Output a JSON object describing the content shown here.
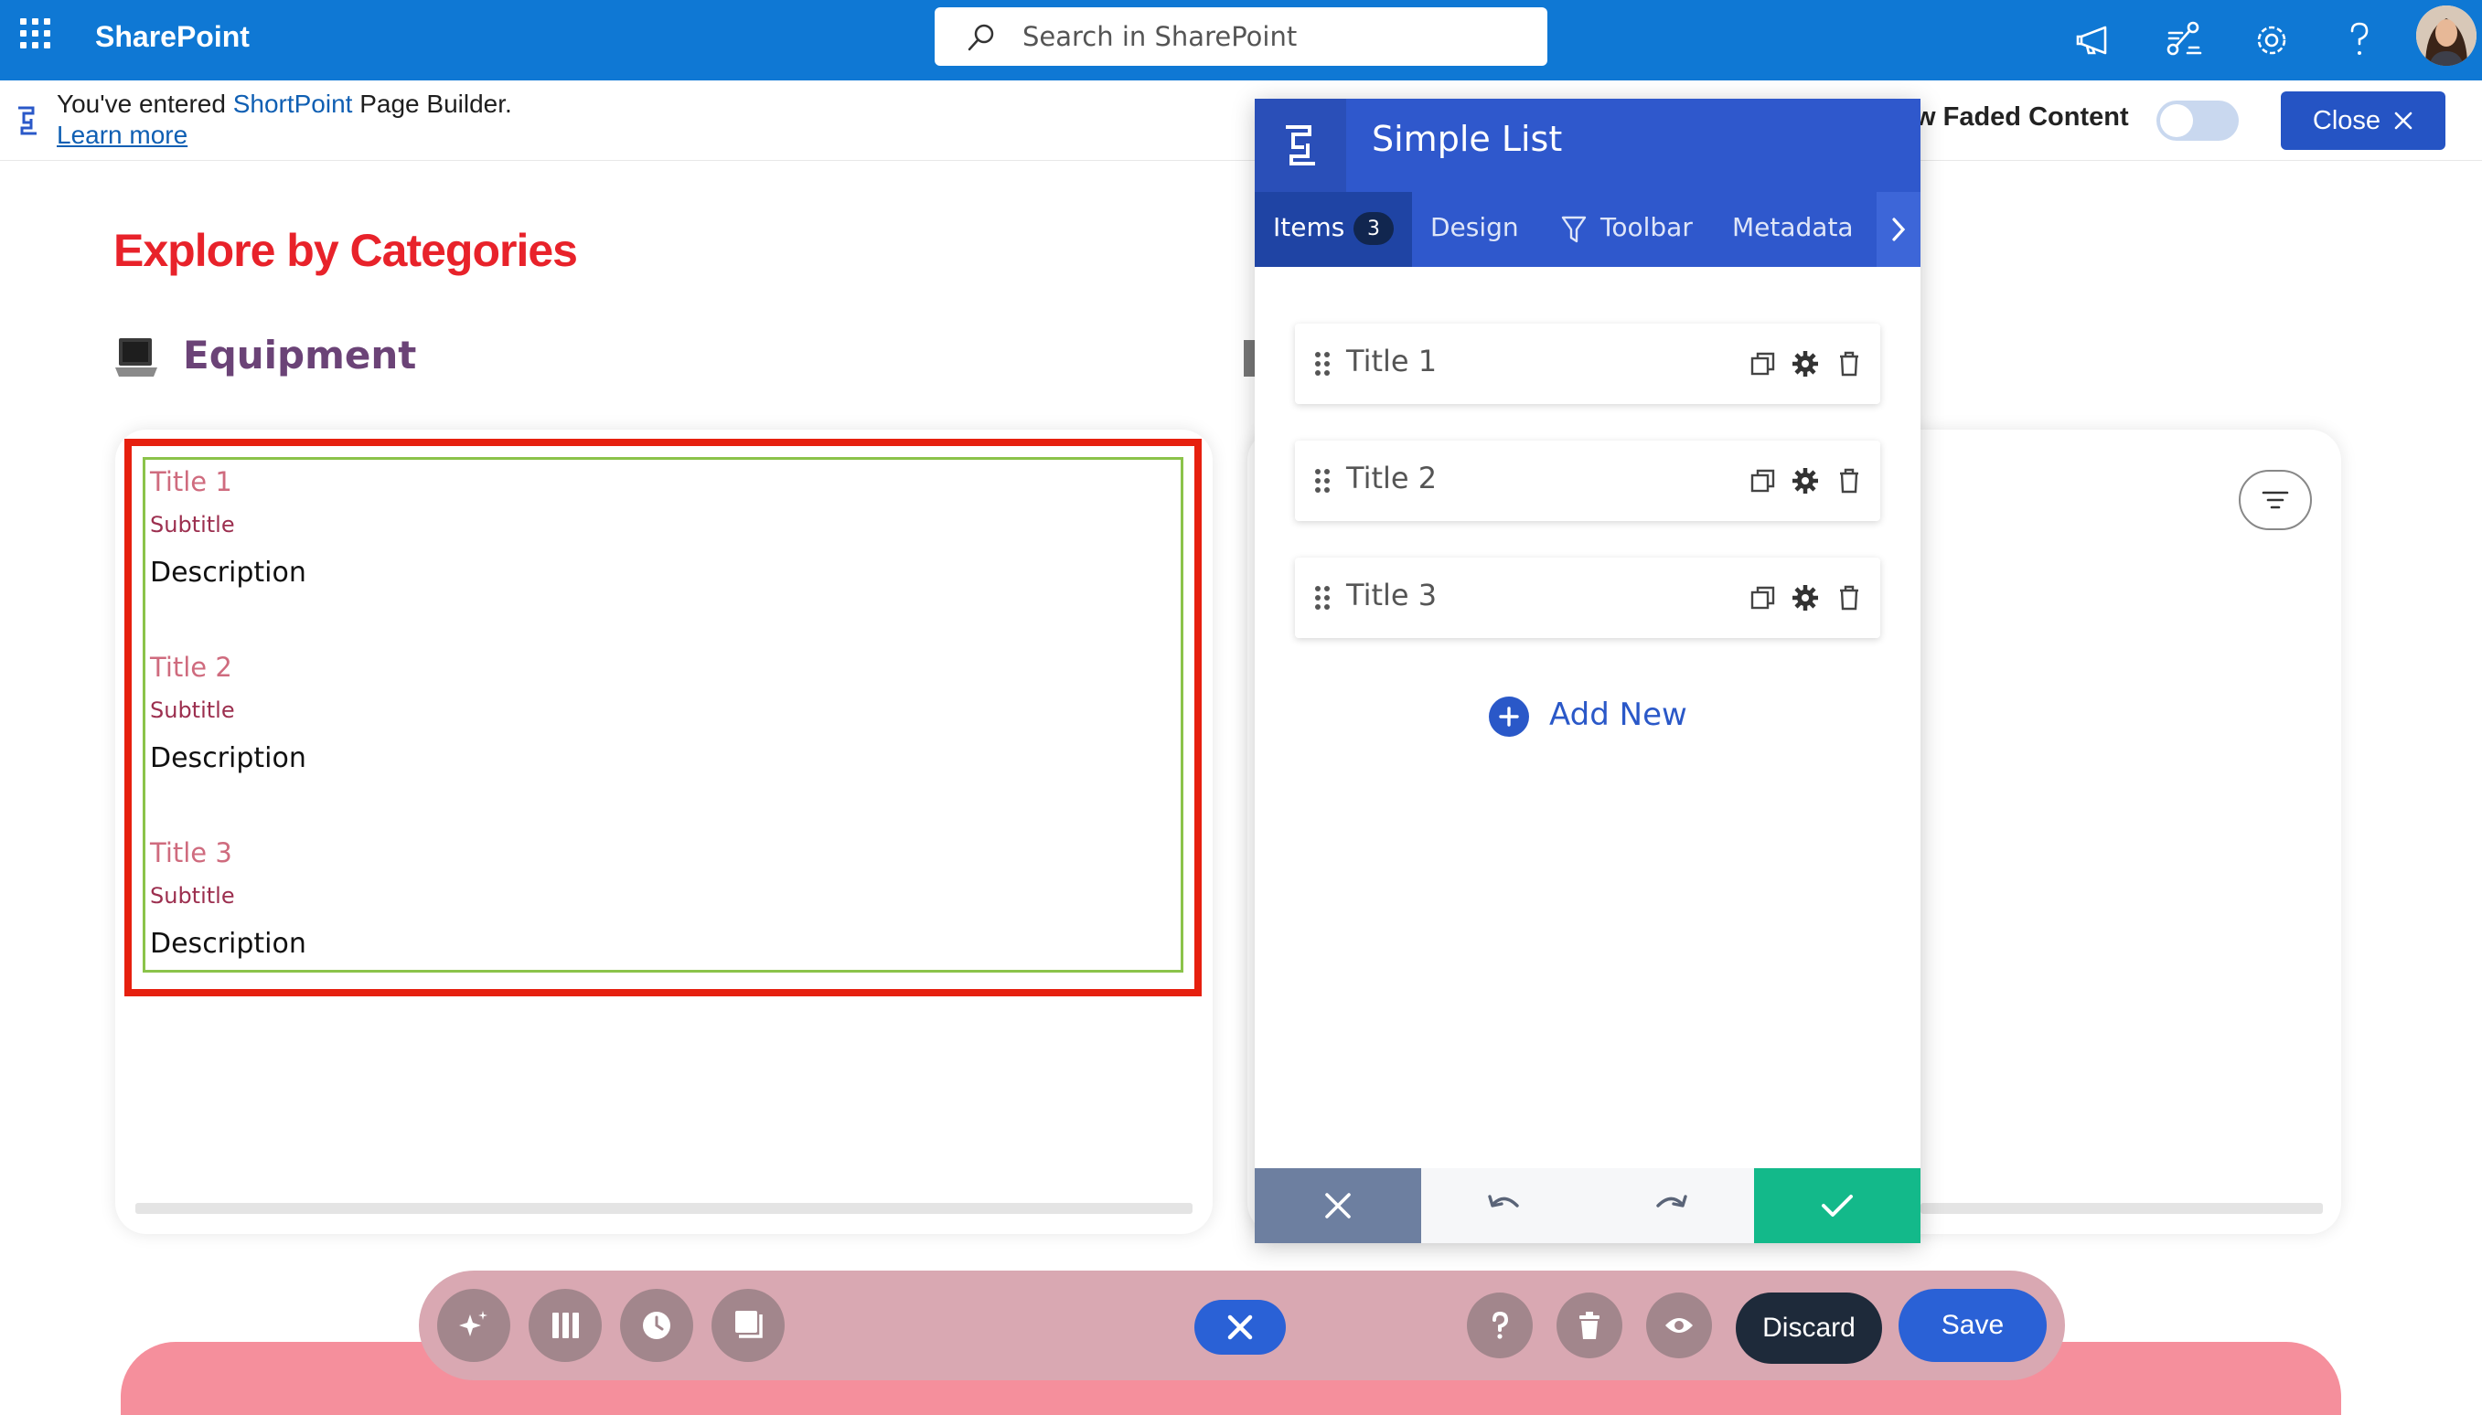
{
  "app": {
    "brand": "SharePoint",
    "search_placeholder": "Search in SharePoint"
  },
  "notice": {
    "prefix": "You've entered ",
    "product": "ShortPoint",
    "suffix": " Page Builder.",
    "learn_more": "Learn more",
    "faded_label": "w Faded Content",
    "close_label": "Close"
  },
  "page": {
    "heading": "Explore by Categories",
    "section_title": "Equipment",
    "list_items": [
      {
        "title": "Title 1",
        "subtitle": "Subtitle",
        "description": "Description"
      },
      {
        "title": "Title 2",
        "subtitle": "Subtitle",
        "description": "Description"
      },
      {
        "title": "Title 3",
        "subtitle": "Subtitle",
        "description": "Description"
      }
    ]
  },
  "panel": {
    "title": "Simple List",
    "tabs": [
      {
        "label": "Items",
        "badge": "3"
      },
      {
        "label": "Design"
      },
      {
        "label": "Toolbar"
      },
      {
        "label": "Metadata"
      }
    ],
    "items": [
      {
        "label": "Title 1"
      },
      {
        "label": "Title 2"
      },
      {
        "label": "Title 3"
      }
    ],
    "add_new": "Add New"
  },
  "toolbar": {
    "discard": "Discard",
    "save": "Save"
  },
  "colors": {
    "sharepoint_blue": "#0f78d4",
    "panel_blue": "#2f58cc",
    "heading_red": "#e8222a",
    "confirm_green": "#13b98a"
  }
}
